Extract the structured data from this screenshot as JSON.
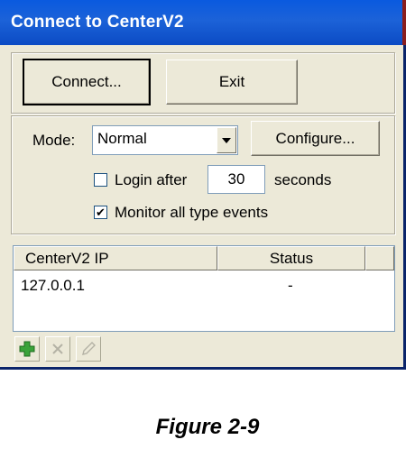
{
  "window": {
    "title": "Connect to CenterV2"
  },
  "buttons": {
    "connect": "Connect...",
    "exit": "Exit",
    "configure": "Configure..."
  },
  "mode": {
    "label": "Mode:",
    "selected": "Normal"
  },
  "login": {
    "label": "Login after",
    "value": "30",
    "unit": "seconds",
    "checked": false
  },
  "monitor": {
    "label": "Monitor all type events",
    "checked": true,
    "check_glyph": "✔"
  },
  "table": {
    "columns": [
      "CenterV2 IP",
      "Status"
    ],
    "rows": [
      {
        "ip": "127.0.0.1",
        "status": "-"
      }
    ]
  },
  "toolbar": {
    "icons": [
      "add-icon",
      "delete-icon",
      "edit-icon"
    ]
  },
  "caption": "Figure 2-9",
  "colors": {
    "title_bar": "#1c62d8",
    "window_bg": "#ece9d8",
    "add_icon": "#3aa33a"
  }
}
